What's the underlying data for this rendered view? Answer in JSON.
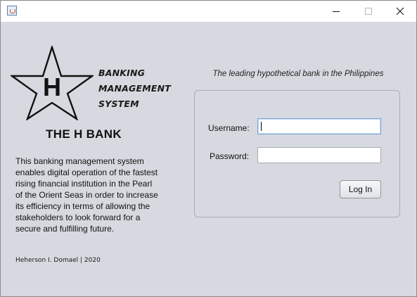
{
  "brand": {
    "logo_letter": "H",
    "system_lines": [
      "BANKING",
      "MANAGEMENT",
      "SYSTEM"
    ],
    "bank_name": "THE H BANK"
  },
  "description": "This banking management system enables digital operation of the fastest rising financial institution in the Pearl of the Orient Seas in order to increase its efficiency in terms of allowing the stakeholders to look forward for a secure and fulfilling future.",
  "footer": {
    "credit": "Heherson I. Domael | 2020"
  },
  "login": {
    "tagline": "The leading hypothetical bank in the Philippines",
    "username_label": "Username:",
    "username_value": "",
    "password_label": "Password:",
    "password_value": "",
    "button_label": "Log In"
  },
  "titlebar": {
    "icons": [
      "java-app-icon",
      "minimize-icon",
      "maximize-icon",
      "close-icon"
    ]
  },
  "colors": {
    "window_background": "#d6d9df",
    "titlebar_background": "#ffffff",
    "focus_border": "#7aa7d9"
  }
}
